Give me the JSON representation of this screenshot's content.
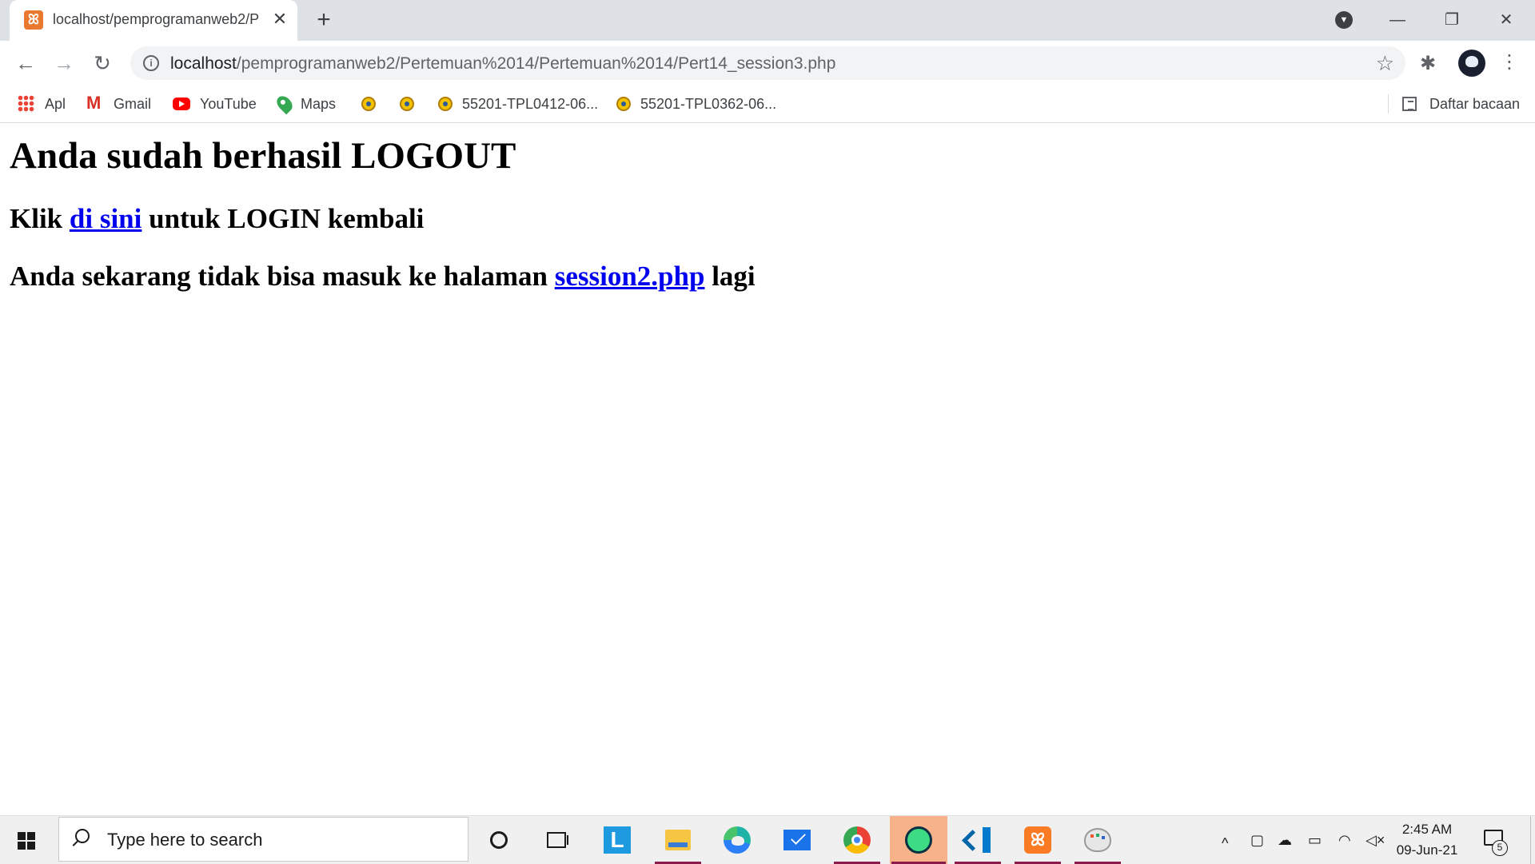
{
  "browser": {
    "tab": {
      "title": "localhost/pemprogramanweb2/P",
      "favicon_glyph": "ꕤ",
      "close_glyph": "✕"
    },
    "new_tab_glyph": "+",
    "tab_search_glyph": "▼",
    "window": {
      "minimize": "—",
      "restore": "❐",
      "close": "✕"
    },
    "nav": {
      "back": "←",
      "forward": "→",
      "reload": "↻"
    },
    "address": {
      "host": "localhost",
      "path": "/pemprogramanweb2/Pertemuan%2014/Pertemuan%2014/Pert14_session3.php",
      "info_glyph": "i",
      "star_glyph": "☆"
    },
    "extensions_glyph": "✱",
    "menu_glyph": "⋮",
    "bookmarks": [
      {
        "label": "Apl",
        "icon": "apps-grid-icon"
      },
      {
        "label": "Gmail",
        "icon": "gmail-icon"
      },
      {
        "label": "YouTube",
        "icon": "youtube-icon"
      },
      {
        "label": "Maps",
        "icon": "maps-icon"
      },
      {
        "label": "",
        "icon": "seal-icon"
      },
      {
        "label": "",
        "icon": "seal-icon"
      },
      {
        "label": "55201-TPL0412-06...",
        "icon": "seal-icon"
      },
      {
        "label": "55201-TPL0362-06...",
        "icon": "seal-icon"
      }
    ],
    "reading_list": "Daftar bacaan"
  },
  "page": {
    "heading": "Anda sudah berhasil LOGOUT",
    "line1": {
      "before": "Klik ",
      "link": "di sini",
      "after": " untuk LOGIN kembali"
    },
    "line2": {
      "before": "Anda sekarang tidak bisa masuk ke halaman ",
      "link": "session2.php",
      "after": " lagi"
    }
  },
  "taskbar": {
    "search_placeholder": "Type here to search",
    "apps": [
      {
        "name": "cortana",
        "active": false
      },
      {
        "name": "task-view",
        "active": false
      },
      {
        "name": "app-l",
        "label": "L",
        "active": false
      },
      {
        "name": "file-explorer",
        "active": true
      },
      {
        "name": "edge",
        "active": false
      },
      {
        "name": "mail",
        "active": false
      },
      {
        "name": "chrome",
        "active": true
      },
      {
        "name": "android-studio",
        "active": true,
        "highlight": true
      },
      {
        "name": "vscode",
        "active": true
      },
      {
        "name": "xampp",
        "label": "ꕤ",
        "active": true
      },
      {
        "name": "paint",
        "active": true
      }
    ],
    "tray": {
      "chevron": "^",
      "time": "2:45 AM",
      "date": "09-Jun-21",
      "notification_count": "5"
    }
  }
}
